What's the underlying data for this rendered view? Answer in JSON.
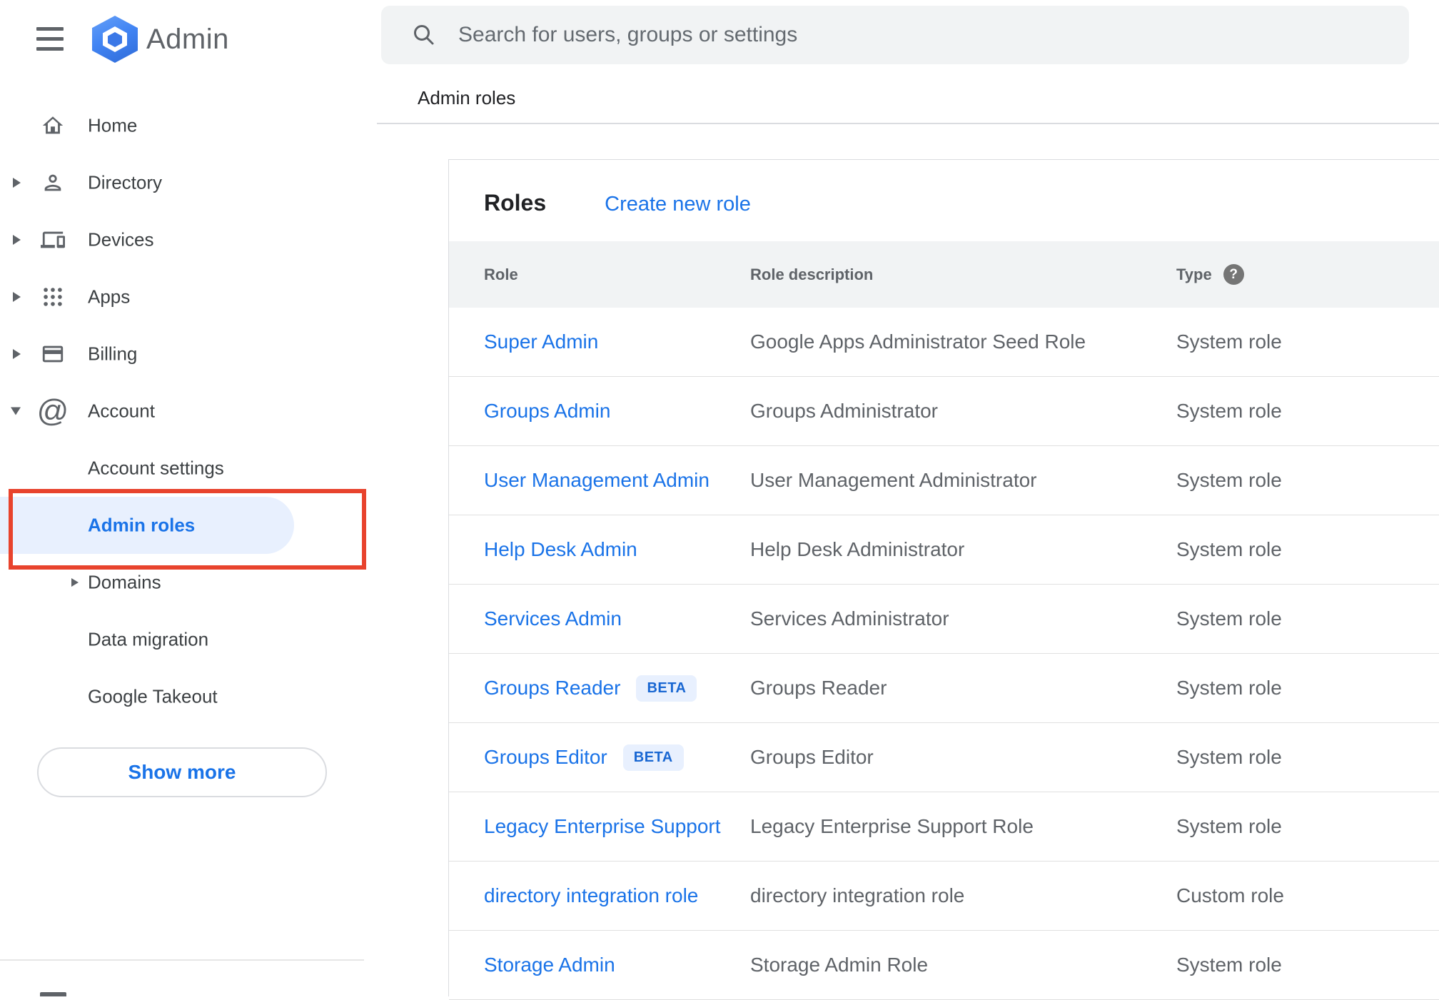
{
  "app": {
    "name": "Admin"
  },
  "topbar": {
    "search_placeholder": "Search for users, groups or settings"
  },
  "breadcrumb": {
    "label": "Admin roles"
  },
  "sidebar": {
    "items": [
      {
        "label": "Home"
      },
      {
        "label": "Directory"
      },
      {
        "label": "Devices"
      },
      {
        "label": "Apps"
      },
      {
        "label": "Billing"
      },
      {
        "label": "Account"
      }
    ],
    "account_children": [
      {
        "label": "Account settings"
      },
      {
        "label": "Admin roles"
      },
      {
        "label": "Domains"
      },
      {
        "label": "Data migration"
      },
      {
        "label": "Google Takeout"
      }
    ],
    "show_more_label": "Show more"
  },
  "content": {
    "card_title": "Roles",
    "create_link_label": "Create new role",
    "table": {
      "columns": {
        "role": "Role",
        "description": "Role description",
        "type": "Type"
      },
      "beta_label": "BETA",
      "rows": [
        {
          "role": "Super Admin",
          "beta": false,
          "description": "Google Apps Administrator Seed Role",
          "type": "System role"
        },
        {
          "role": "Groups Admin",
          "beta": false,
          "description": "Groups Administrator",
          "type": "System role"
        },
        {
          "role": "User Management Admin",
          "beta": false,
          "description": "User Management Administrator",
          "type": "System role"
        },
        {
          "role": "Help Desk Admin",
          "beta": false,
          "description": "Help Desk Administrator",
          "type": "System role"
        },
        {
          "role": "Services Admin",
          "beta": false,
          "description": "Services Administrator",
          "type": "System role"
        },
        {
          "role": "Groups Reader",
          "beta": true,
          "description": "Groups Reader",
          "type": "System role"
        },
        {
          "role": "Groups Editor",
          "beta": true,
          "description": "Groups Editor",
          "type": "System role"
        },
        {
          "role": "Legacy Enterprise Support",
          "beta": false,
          "description": "Legacy Enterprise Support Role",
          "type": "System role"
        },
        {
          "role": "directory integration role",
          "beta": false,
          "description": "directory integration role",
          "type": "Custom role"
        },
        {
          "role": "Storage Admin",
          "beta": false,
          "description": "Storage Admin Role",
          "type": "System role"
        }
      ]
    }
  },
  "colors": {
    "link_blue": "#1a73e8",
    "active_item_bg": "#e8f0fe",
    "annotation_red": "#e8432d",
    "beta_bg": "#e8f0fe",
    "beta_text": "#1967d2",
    "table_header_bg": "#f1f3f4",
    "search_bg": "#f1f3f4",
    "icon_gray": "#5f6368",
    "divider": "#dadce0"
  }
}
